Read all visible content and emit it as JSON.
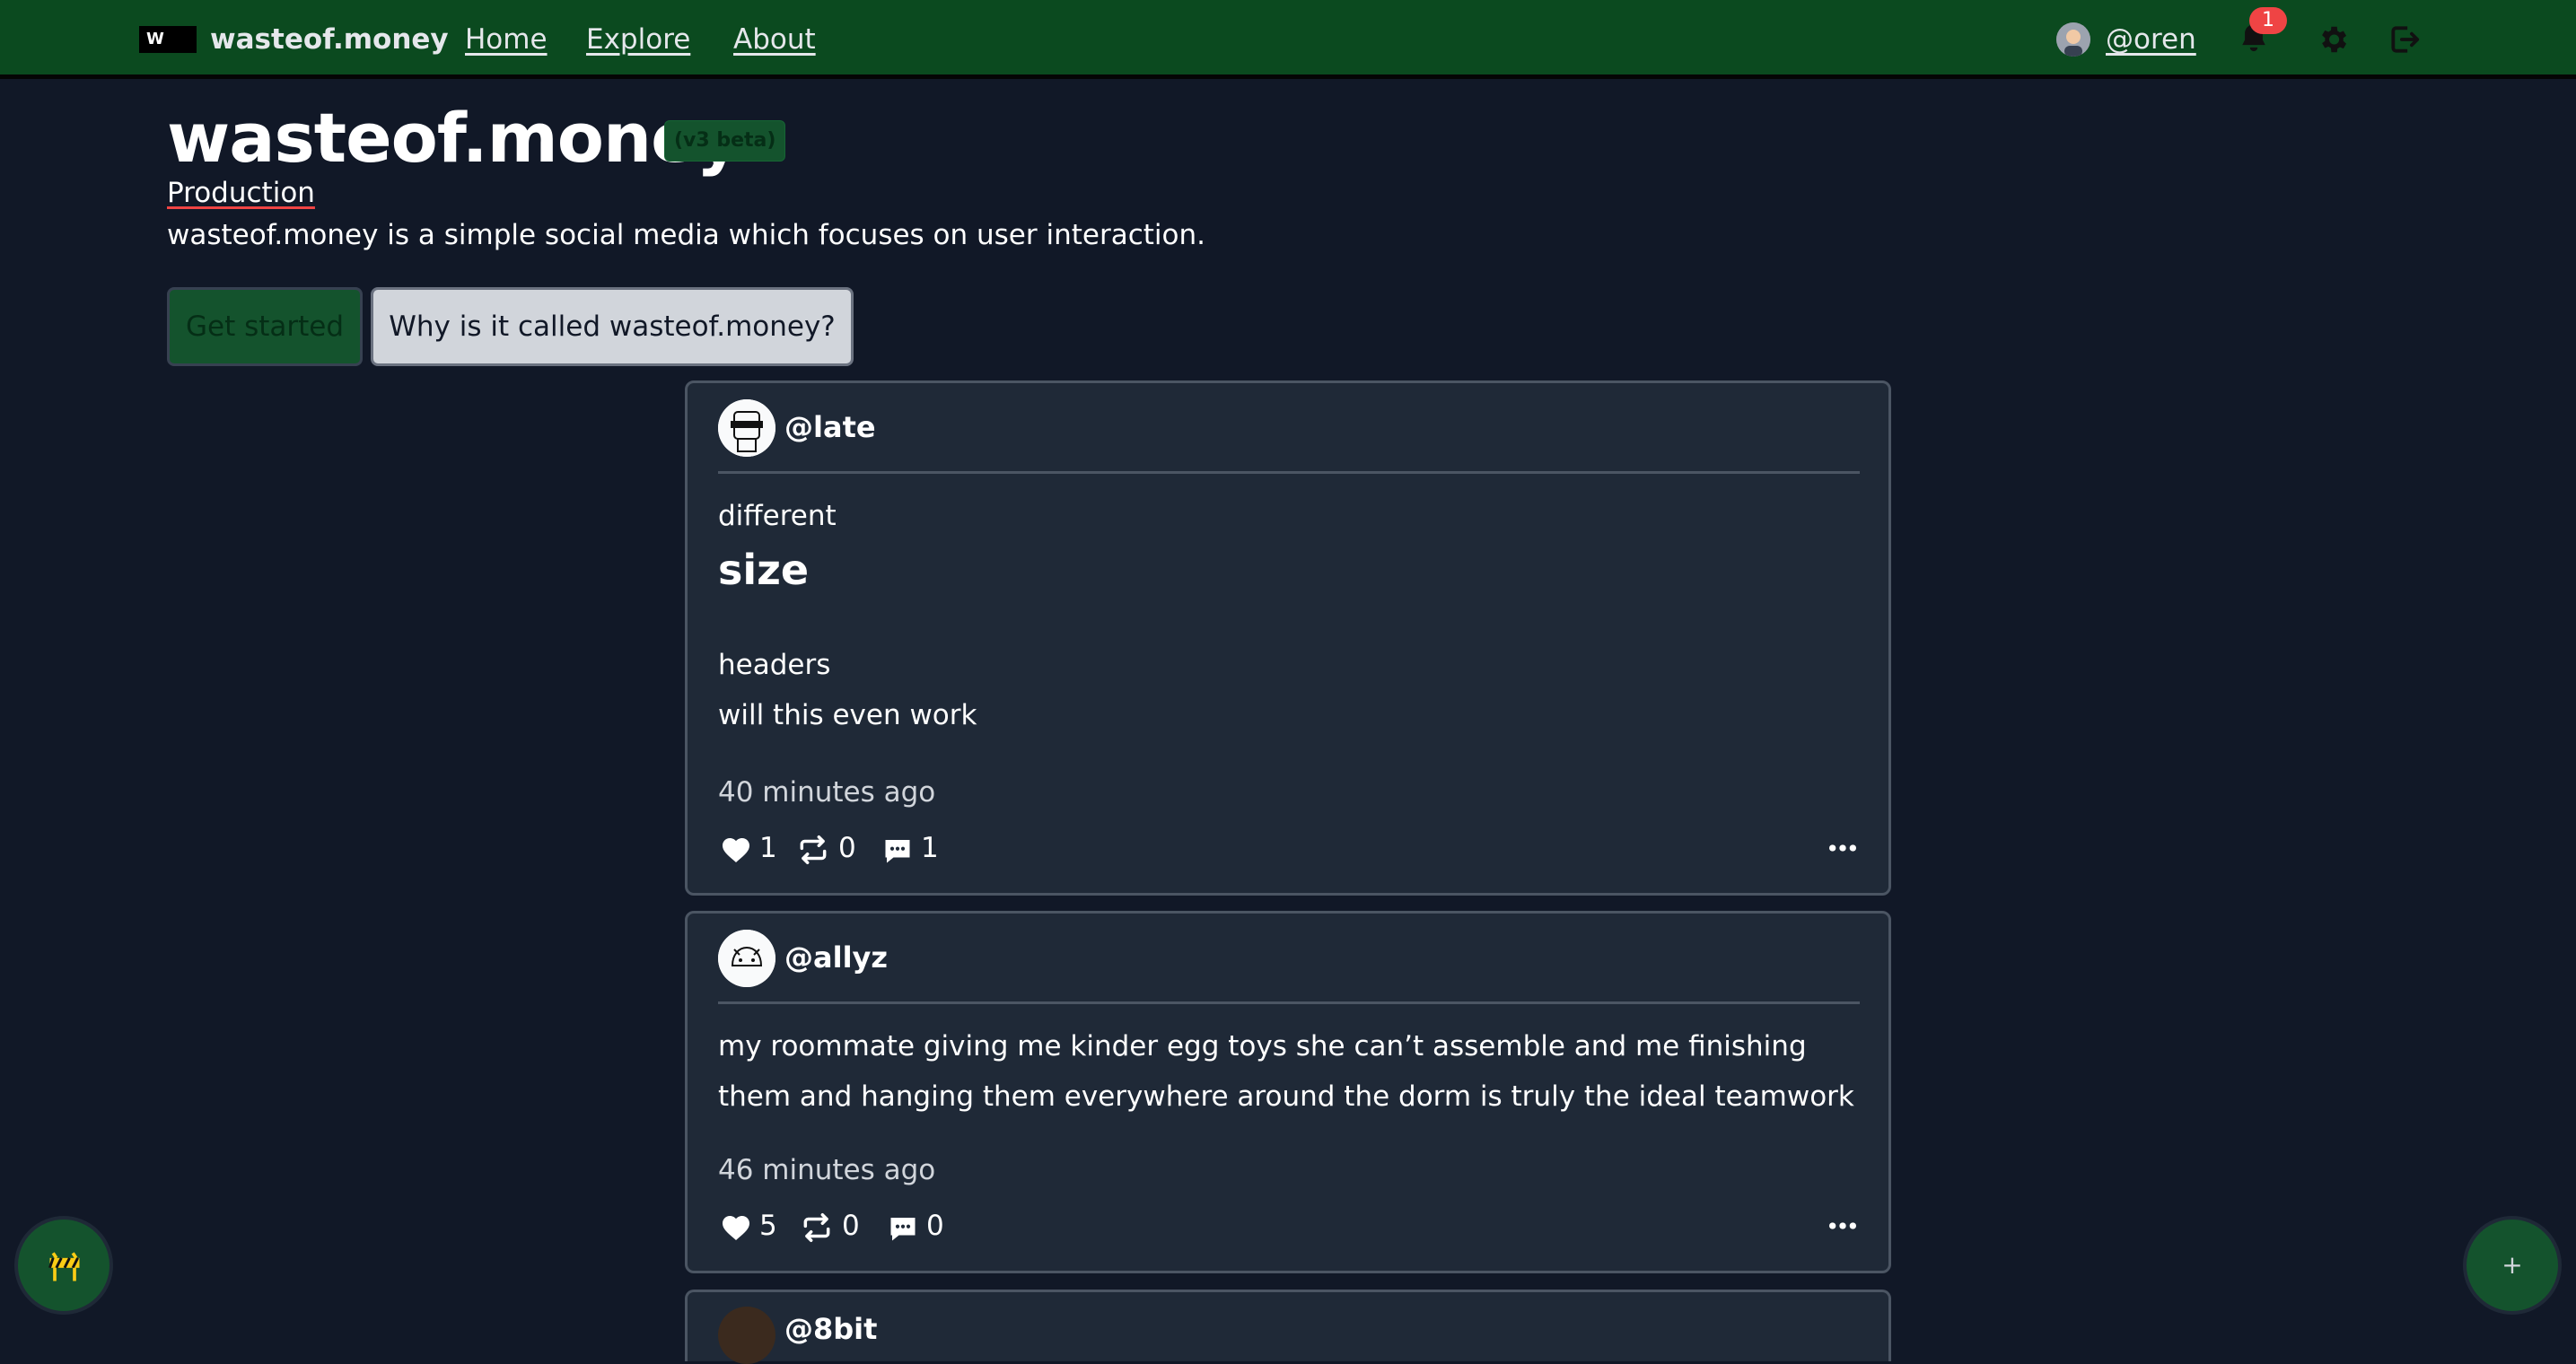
{
  "nav": {
    "logo_mark": "W",
    "brand": "wasteof.money",
    "links": [
      "Home",
      "Explore",
      "About"
    ],
    "user": "@oren",
    "notification_count": "1",
    "icons": [
      "bell-icon",
      "gear-icon",
      "logout-icon"
    ]
  },
  "hero": {
    "title": "wasteof.money",
    "badge": "(v3 beta)",
    "environment": "Production",
    "tagline": "wasteof.money is a simple social media which focuses on user interaction.",
    "get_started": "Get started",
    "why_button": "Why is it called wasteof.money?"
  },
  "posts": [
    {
      "user": "@late",
      "lines": [
        "different",
        "size",
        "headers",
        "will this even work"
      ],
      "time": "40 minutes ago",
      "likes": "1",
      "reposts": "0",
      "comments": "1"
    },
    {
      "user": "@allyz",
      "lines": [
        "my roommate giving me kinder egg toys she can’t assemble and me finishing",
        "them and hanging them everywhere around the dorm is truly the ideal teamwork"
      ],
      "time": "46 minutes ago",
      "likes": "5",
      "reposts": "0",
      "comments": "0"
    },
    {
      "user": "@8bit"
    }
  ],
  "floating": {
    "new_post": "+",
    "left_icon": "construction-barrier-icon"
  },
  "colors": {
    "nav_bg": "#0b4a1f",
    "page_bg": "#111827",
    "card_bg": "#1f2937",
    "accent_green": "#14532d",
    "badge_red": "#ef4444"
  }
}
